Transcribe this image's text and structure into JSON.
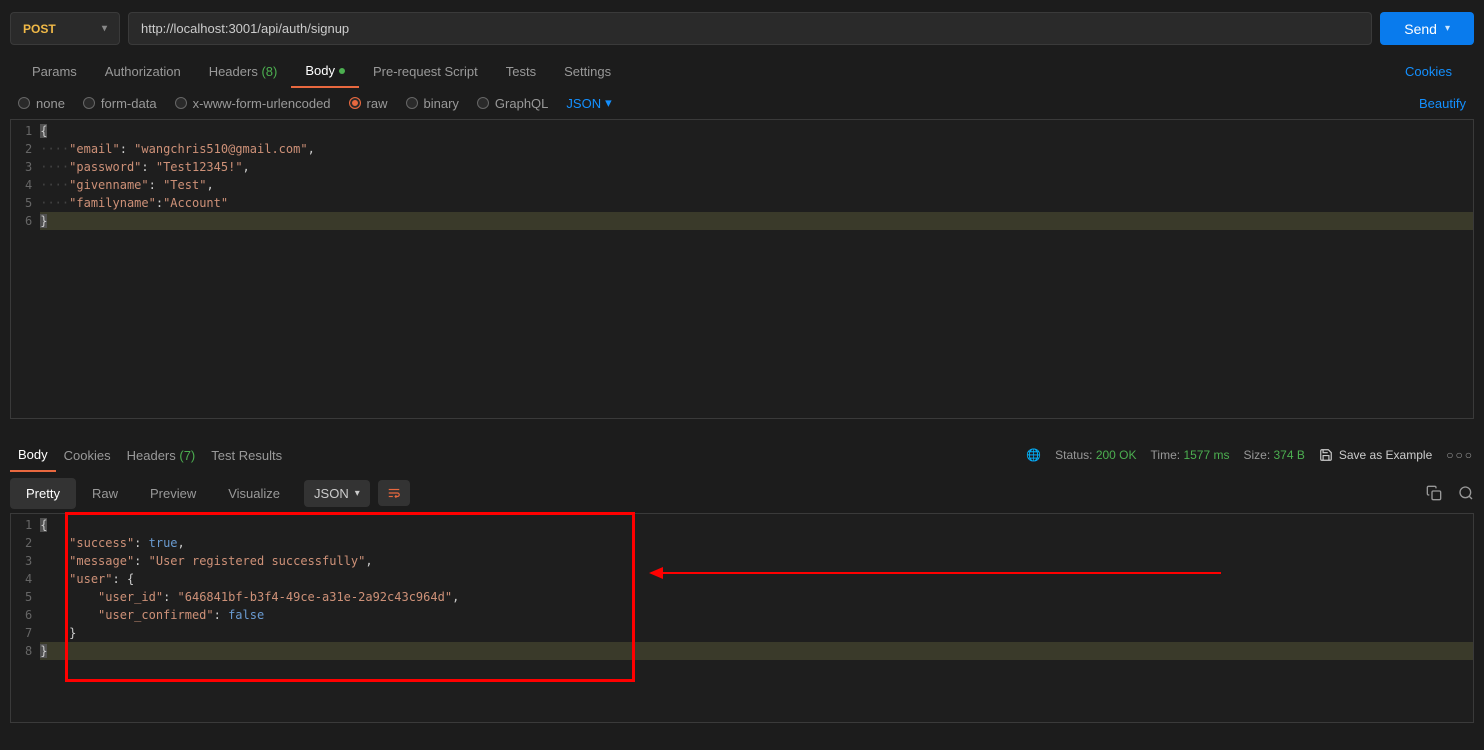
{
  "request": {
    "method": "POST",
    "url": "http://localhost:3001/api/auth/signup",
    "send_label": "Send"
  },
  "tabs": {
    "params": "Params",
    "authorization": "Authorization",
    "headers": "Headers",
    "headers_count": "(8)",
    "body": "Body",
    "prerequest": "Pre-request Script",
    "tests": "Tests",
    "settings": "Settings",
    "cookies_link": "Cookies"
  },
  "body_types": {
    "none": "none",
    "formdata": "form-data",
    "urlencoded": "x-www-form-urlencoded",
    "raw": "raw",
    "binary": "binary",
    "graphql": "GraphQL",
    "format": "JSON",
    "beautify": "Beautify"
  },
  "request_body_lines": [
    {
      "n": "1",
      "indent": "",
      "tokens": [
        {
          "t": "{",
          "c": "punc",
          "sel": true
        }
      ]
    },
    {
      "n": "2",
      "indent": "····",
      "tokens": [
        {
          "t": "\"email\"",
          "c": "key"
        },
        {
          "t": ": ",
          "c": "punc"
        },
        {
          "t": "\"wangchris510@gmail.com\"",
          "c": "str"
        },
        {
          "t": ",",
          "c": "punc"
        }
      ]
    },
    {
      "n": "3",
      "indent": "····",
      "tokens": [
        {
          "t": "\"password\"",
          "c": "key"
        },
        {
          "t": ": ",
          "c": "punc"
        },
        {
          "t": "\"Test12345!\"",
          "c": "str"
        },
        {
          "t": ",",
          "c": "punc"
        }
      ]
    },
    {
      "n": "4",
      "indent": "····",
      "tokens": [
        {
          "t": "\"givenname\"",
          "c": "key"
        },
        {
          "t": ": ",
          "c": "punc"
        },
        {
          "t": "\"Test\"",
          "c": "str"
        },
        {
          "t": ",",
          "c": "punc"
        }
      ]
    },
    {
      "n": "5",
      "indent": "····",
      "tokens": [
        {
          "t": "\"familyname\"",
          "c": "key"
        },
        {
          "t": ":",
          "c": "punc"
        },
        {
          "t": "\"Account\"",
          "c": "str"
        }
      ]
    },
    {
      "n": "6",
      "indent": "",
      "tokens": [
        {
          "t": "}",
          "c": "punc",
          "sel": true
        }
      ],
      "hl": true
    }
  ],
  "response_tabs": {
    "body": "Body",
    "cookies": "Cookies",
    "headers": "Headers",
    "headers_count": "(7)",
    "testresults": "Test Results"
  },
  "status": {
    "status_label": "Status:",
    "status_value": "200 OK",
    "time_label": "Time:",
    "time_value": "1577 ms",
    "size_label": "Size:",
    "size_value": "374 B",
    "save_example": "Save as Example"
  },
  "view": {
    "pretty": "Pretty",
    "raw": "Raw",
    "preview": "Preview",
    "visualize": "Visualize",
    "format": "JSON"
  },
  "response_body_lines": [
    {
      "n": "1",
      "indent": "",
      "tokens": [
        {
          "t": "{",
          "c": "punc",
          "sel": true
        }
      ]
    },
    {
      "n": "2",
      "indent": "    ",
      "tokens": [
        {
          "t": "\"success\"",
          "c": "key"
        },
        {
          "t": ": ",
          "c": "punc"
        },
        {
          "t": "true",
          "c": "bool"
        },
        {
          "t": ",",
          "c": "punc"
        }
      ]
    },
    {
      "n": "3",
      "indent": "    ",
      "tokens": [
        {
          "t": "\"message\"",
          "c": "key"
        },
        {
          "t": ": ",
          "c": "punc"
        },
        {
          "t": "\"User registered successfully\"",
          "c": "str"
        },
        {
          "t": ",",
          "c": "punc"
        }
      ]
    },
    {
      "n": "4",
      "indent": "    ",
      "tokens": [
        {
          "t": "\"user\"",
          "c": "key"
        },
        {
          "t": ": {",
          "c": "punc"
        }
      ]
    },
    {
      "n": "5",
      "indent": "        ",
      "tokens": [
        {
          "t": "\"user_id\"",
          "c": "key"
        },
        {
          "t": ": ",
          "c": "punc"
        },
        {
          "t": "\"646841bf-b3f4-49ce-a31e-2a92c43c964d\"",
          "c": "str"
        },
        {
          "t": ",",
          "c": "punc"
        }
      ]
    },
    {
      "n": "6",
      "indent": "        ",
      "tokens": [
        {
          "t": "\"user_confirmed\"",
          "c": "key"
        },
        {
          "t": ": ",
          "c": "punc"
        },
        {
          "t": "false",
          "c": "bool"
        }
      ]
    },
    {
      "n": "7",
      "indent": "    ",
      "tokens": [
        {
          "t": "}",
          "c": "punc"
        }
      ]
    },
    {
      "n": "8",
      "indent": "",
      "tokens": [
        {
          "t": "}",
          "c": "punc",
          "sel": true
        }
      ],
      "hl": true
    }
  ]
}
